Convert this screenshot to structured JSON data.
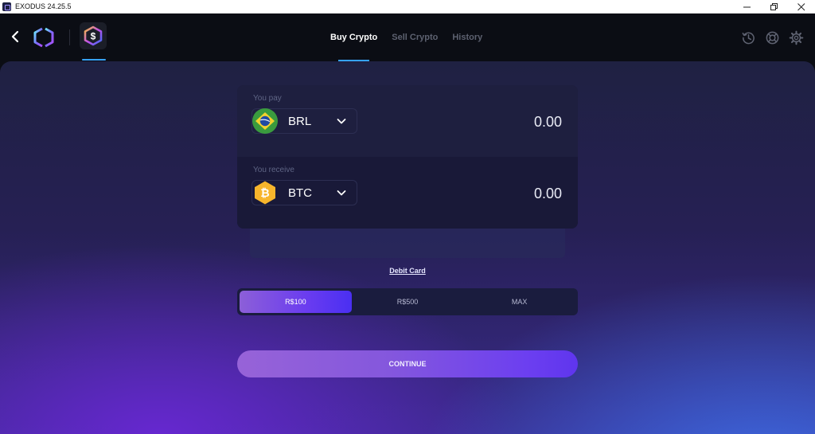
{
  "window": {
    "title": "EXODUS 24.25.5",
    "controls": [
      "minimize",
      "restore",
      "close"
    ]
  },
  "topbar": {
    "back_icon": "chevron-left-icon",
    "logo_icon": "exodus-logo-icon",
    "app_tile_icon": "dollar-hexagon-icon",
    "tabs": [
      {
        "label": "Buy Crypto",
        "active": true
      },
      {
        "label": "Sell Crypto",
        "active": false
      },
      {
        "label": "History",
        "active": false
      }
    ],
    "right_icons": [
      "history-icon",
      "support-lifebuoy-icon",
      "gear-icon"
    ]
  },
  "exchange": {
    "pay": {
      "label": "You pay",
      "currency": "BRL",
      "icon": "brazil-flag-icon",
      "amount": "0.00"
    },
    "receive": {
      "label": "You receive",
      "currency": "BTC",
      "icon": "bitcoin-icon",
      "amount": "0.00"
    }
  },
  "payment_method": "Debit Card",
  "presets": [
    {
      "label": "R$100",
      "active": true
    },
    {
      "label": "R$500",
      "active": false
    },
    {
      "label": "MAX",
      "active": false
    }
  ],
  "continue_label": "CONTINUE",
  "colors": {
    "accent_blue": "#36a2ff",
    "btc_orange": "#f7b52c",
    "brazil_green": "#3a9b3e",
    "brazil_yellow": "#f2d22e",
    "brazil_blue": "#1f4aa3"
  }
}
